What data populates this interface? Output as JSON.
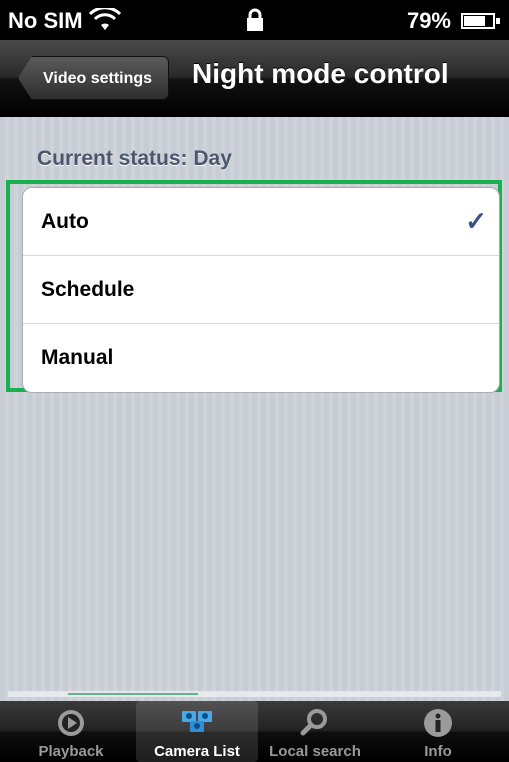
{
  "status_bar": {
    "carrier": "No SIM",
    "battery": "79%",
    "battery_level": 0.79,
    "icons": [
      "wifi-icon",
      "lock-icon",
      "battery-icon"
    ]
  },
  "nav": {
    "back_label": "Video settings",
    "title": "Night mode control"
  },
  "content": {
    "status_text": "Current status: Day",
    "options": [
      {
        "label": "Auto",
        "selected": true
      },
      {
        "label": "Schedule",
        "selected": false
      },
      {
        "label": "Manual",
        "selected": false
      }
    ],
    "checkmark": "✓",
    "highlight_color": "#17b24f"
  },
  "tabs": [
    {
      "label": "Playback",
      "icon": "playback-icon",
      "selected": false
    },
    {
      "label": "Camera List",
      "icon": "camera-list-icon",
      "selected": true
    },
    {
      "label": "Local search",
      "icon": "search-icon",
      "selected": false
    },
    {
      "label": "Info",
      "icon": "info-icon",
      "selected": false
    }
  ]
}
